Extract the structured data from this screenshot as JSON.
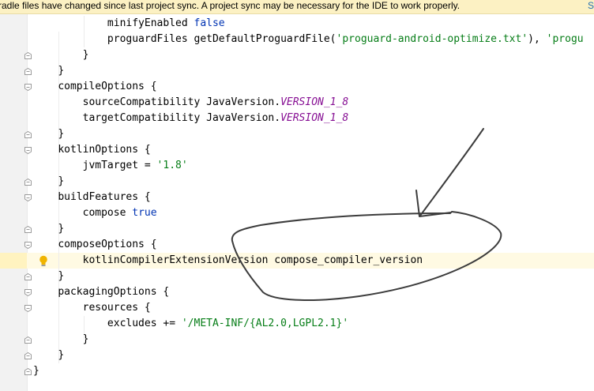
{
  "banner": {
    "message": "radle files have changed since last project sync. A project sync may be necessary for the IDE to work properly.",
    "action": "S"
  },
  "code": [
    {
      "indent": 3,
      "tokens": [
        {
          "t": "minifyEnabled "
        },
        {
          "t": "false",
          "c": "kw"
        }
      ]
    },
    {
      "indent": 3,
      "tokens": [
        {
          "t": "proguardFiles getDefaultProguardFile("
        },
        {
          "t": "'proguard-android-optimize.txt'",
          "c": "str"
        },
        {
          "t": "), "
        },
        {
          "t": "'progu",
          "c": "str"
        }
      ]
    },
    {
      "indent": 2,
      "tokens": [
        {
          "t": "}"
        }
      ]
    },
    {
      "indent": 1,
      "tokens": [
        {
          "t": "}"
        }
      ]
    },
    {
      "indent": 1,
      "tokens": [
        {
          "t": "compileOptions {"
        }
      ]
    },
    {
      "indent": 2,
      "tokens": [
        {
          "t": "sourceCompatibility JavaVersion."
        },
        {
          "t": "VERSION_1_8",
          "c": "const"
        }
      ]
    },
    {
      "indent": 2,
      "tokens": [
        {
          "t": "targetCompatibility JavaVersion."
        },
        {
          "t": "VERSION_1_8",
          "c": "const"
        }
      ]
    },
    {
      "indent": 1,
      "tokens": [
        {
          "t": "}"
        }
      ]
    },
    {
      "indent": 1,
      "tokens": [
        {
          "t": "kotlinOptions {"
        }
      ]
    },
    {
      "indent": 2,
      "tokens": [
        {
          "t": "jvmTarget = "
        },
        {
          "t": "'1.8'",
          "c": "str"
        }
      ]
    },
    {
      "indent": 1,
      "tokens": [
        {
          "t": "}"
        }
      ]
    },
    {
      "indent": 1,
      "tokens": [
        {
          "t": "buildFeatures {"
        }
      ]
    },
    {
      "indent": 2,
      "tokens": [
        {
          "t": "compose "
        },
        {
          "t": "true",
          "c": "kw"
        }
      ]
    },
    {
      "indent": 1,
      "tokens": [
        {
          "t": "}"
        }
      ]
    },
    {
      "indent": 1,
      "tokens": [
        {
          "t": "composeOptions {"
        }
      ]
    },
    {
      "indent": 2,
      "tokens": [
        {
          "t": "kotlinCompilerExtensionVersion compose_compiler_version"
        }
      ]
    },
    {
      "indent": 1,
      "tokens": [
        {
          "t": "}"
        }
      ]
    },
    {
      "indent": 1,
      "tokens": [
        {
          "t": "packagingOptions {"
        }
      ]
    },
    {
      "indent": 2,
      "tokens": [
        {
          "t": "resources {"
        }
      ]
    },
    {
      "indent": 3,
      "tokens": [
        {
          "t": "excludes += "
        },
        {
          "t": "'/META-INF/{AL2.0,LGPL2.1}'",
          "c": "str"
        }
      ]
    },
    {
      "indent": 2,
      "tokens": [
        {
          "t": "}"
        }
      ]
    },
    {
      "indent": 1,
      "tokens": [
        {
          "t": "}"
        }
      ]
    },
    {
      "indent": 0,
      "tokens": [
        {
          "t": "}"
        }
      ]
    }
  ],
  "icons": {
    "bulb": "lightbulb-icon",
    "fold": "fold-marker-icon"
  }
}
